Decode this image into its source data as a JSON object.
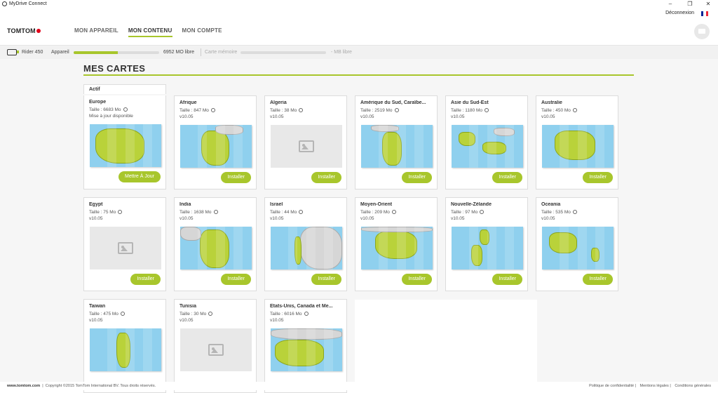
{
  "window": {
    "title": "MyDrive Connect",
    "minimize": "–",
    "maximize": "❐",
    "close": "✕"
  },
  "header": {
    "logout": "Déconnexion",
    "logo": "TOMTOM",
    "nav": [
      "MON APPAREIL",
      "MON CONTENU",
      "MON COMPTE"
    ],
    "active_nav": "MON CONTENU",
    "flag_colors": [
      "#002395",
      "#ffffff",
      "#ed2939"
    ]
  },
  "status": {
    "device": "Rider 450",
    "device_label": "Appareil",
    "device_fill": 0.52,
    "device_free": "6952 MO libre",
    "card_label": "Carte mémoire",
    "card_fill": 0,
    "card_free": "- MB libre"
  },
  "section": {
    "title": "MES CARTES",
    "tab": "Actif"
  },
  "colors": {
    "accent": "#a8c62c",
    "sea": "#8fd0ee",
    "land": "#b9d23a"
  },
  "cards": [
    {
      "name": "Europe",
      "size": "Taille : 6683 Mo",
      "version": "Mise à jour disponible",
      "button": "Mettre À Jour",
      "thumb": "europe"
    },
    {
      "name": "Afrique",
      "size": "Taille : 847 Mo",
      "version": "v10.05",
      "button": "Installer",
      "thumb": "africa"
    },
    {
      "name": "Algeria",
      "size": "Taille : 38 Mo",
      "version": "v10.05",
      "button": "Installer",
      "thumb": "placeholder"
    },
    {
      "name": "Amérique du Sud, Caraïbe...",
      "size": "Taille : 2519 Mo",
      "version": "v10.05",
      "button": "Installer",
      "thumb": "samerica"
    },
    {
      "name": "Asie du Sud-Est",
      "size": "Taille : 1180 Mo",
      "version": "v10.05",
      "button": "Installer",
      "thumb": "seasia"
    },
    {
      "name": "Australie",
      "size": "Taille : 450 Mo",
      "version": "v10.05",
      "button": "Installer",
      "thumb": "australia"
    },
    {
      "name": "Egypt",
      "size": "Taille : 75 Mo",
      "version": "v10.05",
      "button": "Installer",
      "thumb": "placeholder"
    },
    {
      "name": "India",
      "size": "Taille : 1638 Mo",
      "version": "v10.05",
      "button": "Installer",
      "thumb": "india"
    },
    {
      "name": "Israel",
      "size": "Taille : 44 Mo",
      "version": "v10.05",
      "button": "Installer",
      "thumb": "israel"
    },
    {
      "name": "Moyen-Orient",
      "size": "Taille : 209 Mo",
      "version": "v10.05",
      "button": "Installer",
      "thumb": "mideast"
    },
    {
      "name": "Nouvelle-Zélande",
      "size": "Taille : 97 Mo",
      "version": "v10.05",
      "button": "Installer",
      "thumb": "nz"
    },
    {
      "name": "Oceania",
      "size": "Taille : 535 Mo",
      "version": "v10.05",
      "button": "Installer",
      "thumb": "oceania"
    },
    {
      "name": "Taiwan",
      "size": "Taille : 475 Mo",
      "version": "v10.05",
      "button": "",
      "thumb": "taiwan"
    },
    {
      "name": "Tunisia",
      "size": "Taille : 30 Mo",
      "version": "v10.05",
      "button": "",
      "thumb": "placeholder"
    },
    {
      "name": "États-Unis, Canada et Me...",
      "size": "Taille : 6016 Mo",
      "version": "v10.05",
      "button": "",
      "thumb": "usa"
    }
  ],
  "footer": {
    "site": "www.tomtom.com",
    "copyright": "Copyright ©2015 TomTom International BV. Tous droits réservés.",
    "links": [
      "Politique de confidentialité",
      "Mentions légales",
      "Conditions générales"
    ]
  }
}
